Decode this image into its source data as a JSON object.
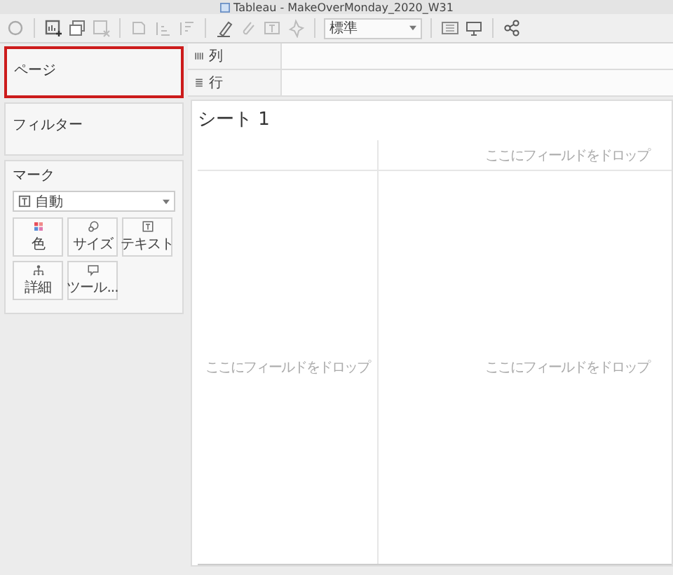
{
  "window": {
    "title": "Tableau - MakeOverMonday_2020_W31"
  },
  "toolbar": {
    "fit_dropdown": "標準"
  },
  "pages_card": {
    "title": "ページ",
    "selected": true
  },
  "filters_card": {
    "title": "フィルター"
  },
  "marks_card": {
    "title": "マーク",
    "mark_type": "自動",
    "buttons": [
      {
        "kind": "color",
        "label": "色"
      },
      {
        "kind": "size",
        "label": "サイズ"
      },
      {
        "kind": "text",
        "label": "テキスト"
      },
      {
        "kind": "detail",
        "label": "詳細"
      },
      {
        "kind": "tooltip",
        "label": "ツール..."
      }
    ]
  },
  "shelves": [
    {
      "kind": "columns",
      "label": "列"
    },
    {
      "kind": "rows",
      "label": "行"
    }
  ],
  "sheet": {
    "title": "シート 1",
    "column_hint": "ここにフィールドをドロップ",
    "row_hint": "ここにフィールドをドロップ",
    "view_hint": "ここにフィールドをドロップ"
  }
}
